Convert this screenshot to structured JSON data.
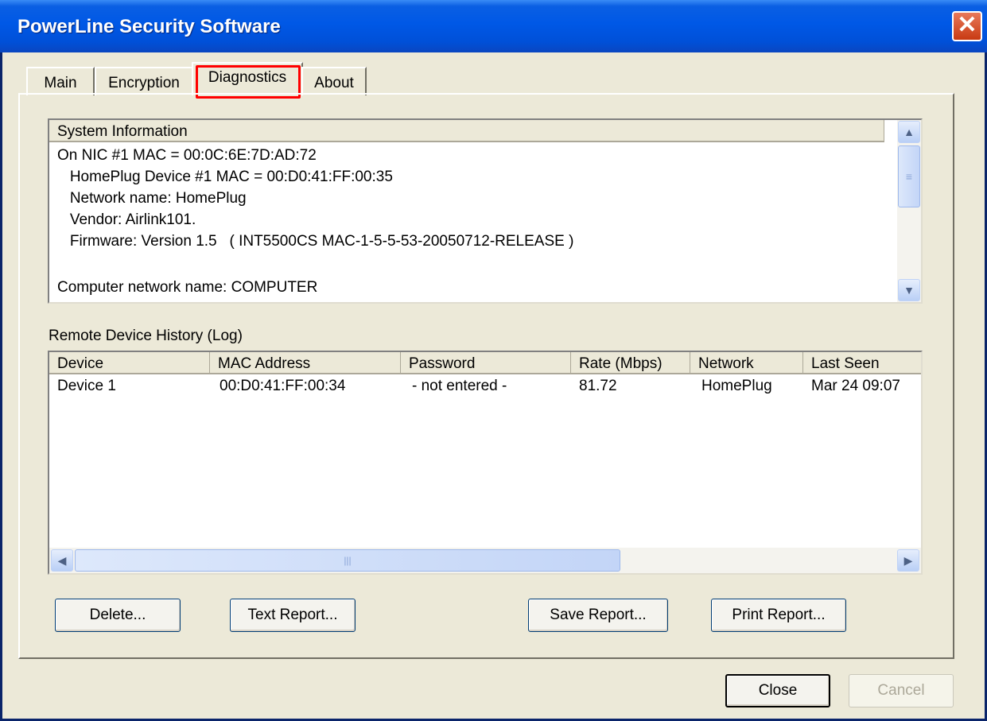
{
  "window": {
    "title": "PowerLine Security Software",
    "close_glyph": "✕"
  },
  "tabs": [
    {
      "label": "Main"
    },
    {
      "label": "Encryption"
    },
    {
      "label": "Diagnostics"
    },
    {
      "label": "About"
    }
  ],
  "system_info": {
    "header": "System Information",
    "lines": [
      "On NIC #1 MAC = 00:0C:6E:7D:AD:72",
      "   HomePlug Device #1 MAC = 00:D0:41:FF:00:35",
      "   Network name: HomePlug",
      "   Vendor: Airlink101.",
      "   Firmware: Version 1.5   ( INT5500CS MAC-1-5-5-53-20050712-RELEASE )",
      "",
      "Computer network name: COMPUTER"
    ]
  },
  "history": {
    "label": "Remote Device History (Log)",
    "columns": [
      "Device",
      "MAC Address",
      "Password",
      "Rate (Mbps)",
      "Network",
      "Last Seen"
    ],
    "rows": [
      [
        "Device 1",
        "00:D0:41:FF:00:34",
        "- not entered -",
        "81.72",
        "HomePlug",
        "Mar 24 09:07"
      ]
    ]
  },
  "actions": {
    "delete": "Delete...",
    "text_report": "Text Report...",
    "save_report": "Save Report...",
    "print_report": "Print Report..."
  },
  "footer": {
    "close": "Close",
    "cancel": "Cancel"
  },
  "icons": {
    "scroll_up": "▲",
    "scroll_down": "▼",
    "scroll_left": "◀",
    "scroll_right": "▶",
    "grip": "≡",
    "hgrip": "|||"
  },
  "colors": {
    "titlebar": "#0058e6",
    "highlight": "#ff0000",
    "face": "#ece9d8"
  }
}
